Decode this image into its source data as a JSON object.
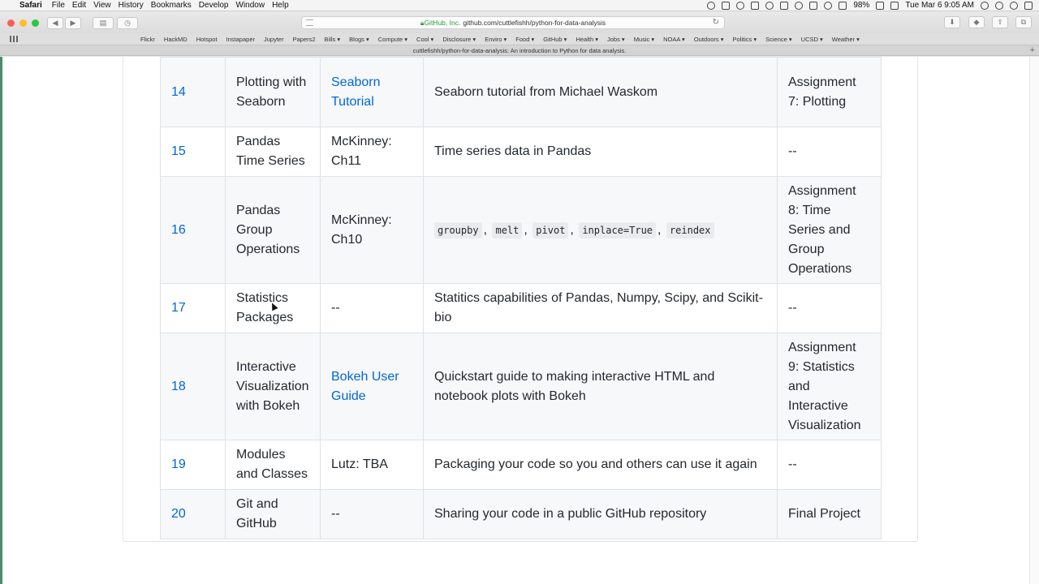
{
  "menubar": {
    "items": [
      "Safari",
      "File",
      "Edit",
      "View",
      "History",
      "Bookmarks",
      "Develop",
      "Window",
      "Help"
    ],
    "battery": "98%",
    "clock": "Tue Mar 6  9:05 AM"
  },
  "toolbar": {
    "url_org": "GitHub, Inc.",
    "url_host": "github.com/cuttlefishh/python-for-data-analysis"
  },
  "favorites": [
    "Flickr",
    "HackMD",
    "Hotspot",
    "Instapaper",
    "Jupyter",
    "Papers2",
    "Bills ▾",
    "Blogs ▾",
    "Compute ▾",
    "Cool ▾",
    "Disclosure ▾",
    "Enviro ▾",
    "Food ▾",
    "GitHub ▾",
    "Health ▾",
    "Jobs ▾",
    "Music ▾",
    "NOAA ▾",
    "Outdoors ▾",
    "Politics ▾",
    "Science ▾",
    "UCSD ▾",
    "Weather ▾"
  ],
  "tab": {
    "title": "cuttlefishh/python-for-data-analysis: An introduction to Python for data analysis."
  },
  "schedule": {
    "rows": [
      {
        "num": "14",
        "topic": "Plotting with Seaborn",
        "reading": "Seaborn Tutorial",
        "reading_link": true,
        "desc": "Seaborn tutorial from Michael Waskom",
        "assignment": "Assignment 7: Plotting"
      },
      {
        "num": "15",
        "topic": "Pandas Time Series",
        "reading": "McKinney: Ch11",
        "reading_link": false,
        "desc": "Time series data in Pandas",
        "assignment": "--"
      },
      {
        "num": "16",
        "topic": "Pandas Group Operations",
        "reading": "McKinney: Ch10",
        "reading_link": false,
        "codes": [
          "groupby",
          "melt",
          "pivot",
          "inplace=True",
          "reindex"
        ],
        "assignment": "Assignment 8: Time Series and Group Operations"
      },
      {
        "num": "17",
        "topic": "Statistics Packages",
        "reading": "--",
        "reading_link": false,
        "desc": "Statitics capabilities of Pandas, Numpy, Scipy, and Scikit-bio",
        "assignment": "--"
      },
      {
        "num": "18",
        "topic": "Interactive Visualization with Bokeh",
        "reading": "Bokeh User Guide",
        "reading_link": true,
        "desc": "Quickstart guide to making interactive HTML and notebook plots with Bokeh",
        "assignment": "Assignment 9: Statistics and Interactive Visualization"
      },
      {
        "num": "19",
        "topic": "Modules and Classes",
        "reading": "Lutz: TBA",
        "reading_link": false,
        "desc": "Packaging your code so you and others can use it again",
        "assignment": "--"
      },
      {
        "num": "20",
        "topic": "Git and GitHub",
        "reading": "--",
        "reading_link": false,
        "desc": "Sharing your code in a public GitHub repository",
        "assignment": "Final Project"
      }
    ]
  }
}
